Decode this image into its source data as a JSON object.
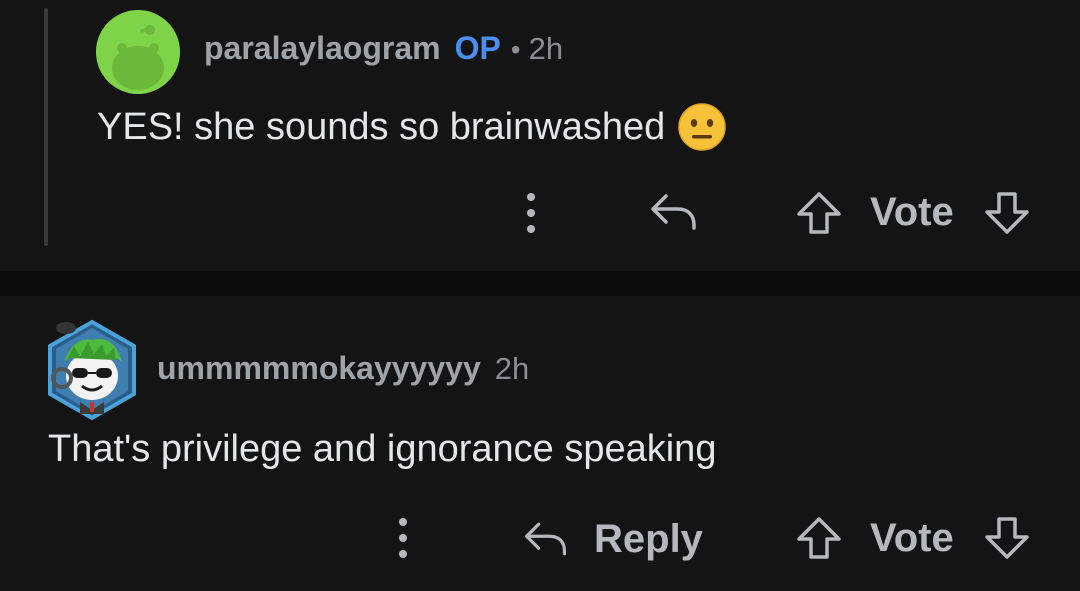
{
  "comments": [
    {
      "username": "paralaylaogram",
      "op_badge": "OP",
      "separator": "•",
      "time": "2h",
      "text": "YES! she sounds so brainwashed",
      "emoji_icon": "neutral-face-icon",
      "vote_label": "Vote",
      "avatar_color": "#7ed348"
    },
    {
      "username": "ummmmmokayyyyyy",
      "time": "2h",
      "text": "That's privilege and ignorance speaking",
      "reply_label": "Reply",
      "vote_label": "Vote"
    }
  ],
  "colors": {
    "background": "#0b0b0b",
    "card": "#141415",
    "op_badge": "#4c8ef0",
    "username": "#a0a3a6",
    "body_text": "#e4e6e8"
  }
}
